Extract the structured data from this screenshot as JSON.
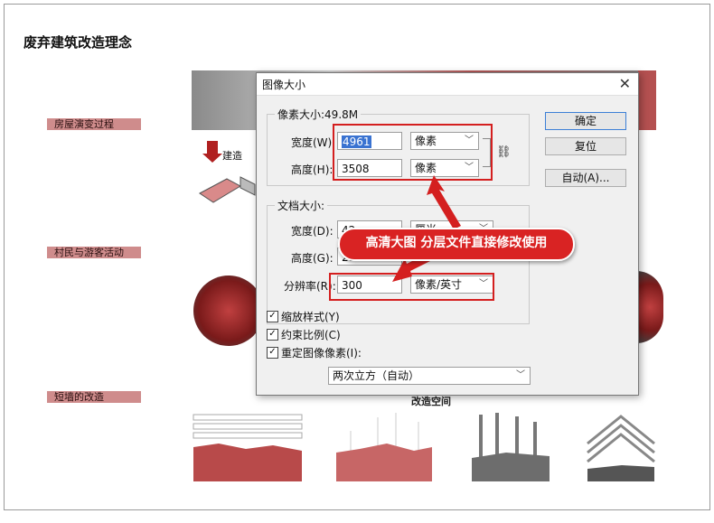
{
  "poster": {
    "title": "废弃建筑改造理念",
    "tags": [
      "房屋演变过程",
      "村民与游客活动",
      "短墙的改造"
    ],
    "build_label": "建造",
    "bottom_label": "改造空间"
  },
  "dialog": {
    "title": "图像大小",
    "close": "✕",
    "pixel_size_label": "像素大小:49.8M",
    "width_label": "宽度(W):",
    "width_value": "4961",
    "width_unit": "像素",
    "height_label": "高度(H):",
    "height_value": "3508",
    "height_unit": "像素",
    "doc_size_label": "文档大小:",
    "doc_width_label": "宽度(D):",
    "doc_width_value": "42",
    "doc_width_unit": "厘米",
    "doc_height_label": "高度(G):",
    "doc_height_value": "29",
    "resolution_label": "分辨率(R):",
    "resolution_value": "300",
    "resolution_unit": "像素/英寸",
    "chk_scale_styles": "缩放样式(Y)",
    "chk_constrain": "约束比例(C)",
    "chk_resample": "重定图像像素(I):",
    "resample_method": "两次立方（自动）",
    "ok_button": "确定",
    "reset_button": "复位",
    "auto_button": "自动(A)...",
    "link_icon": "chain-link-icon"
  },
  "annotation": {
    "banner": "高清大图  分层文件直接修改使用",
    "accent": "#d92323"
  }
}
